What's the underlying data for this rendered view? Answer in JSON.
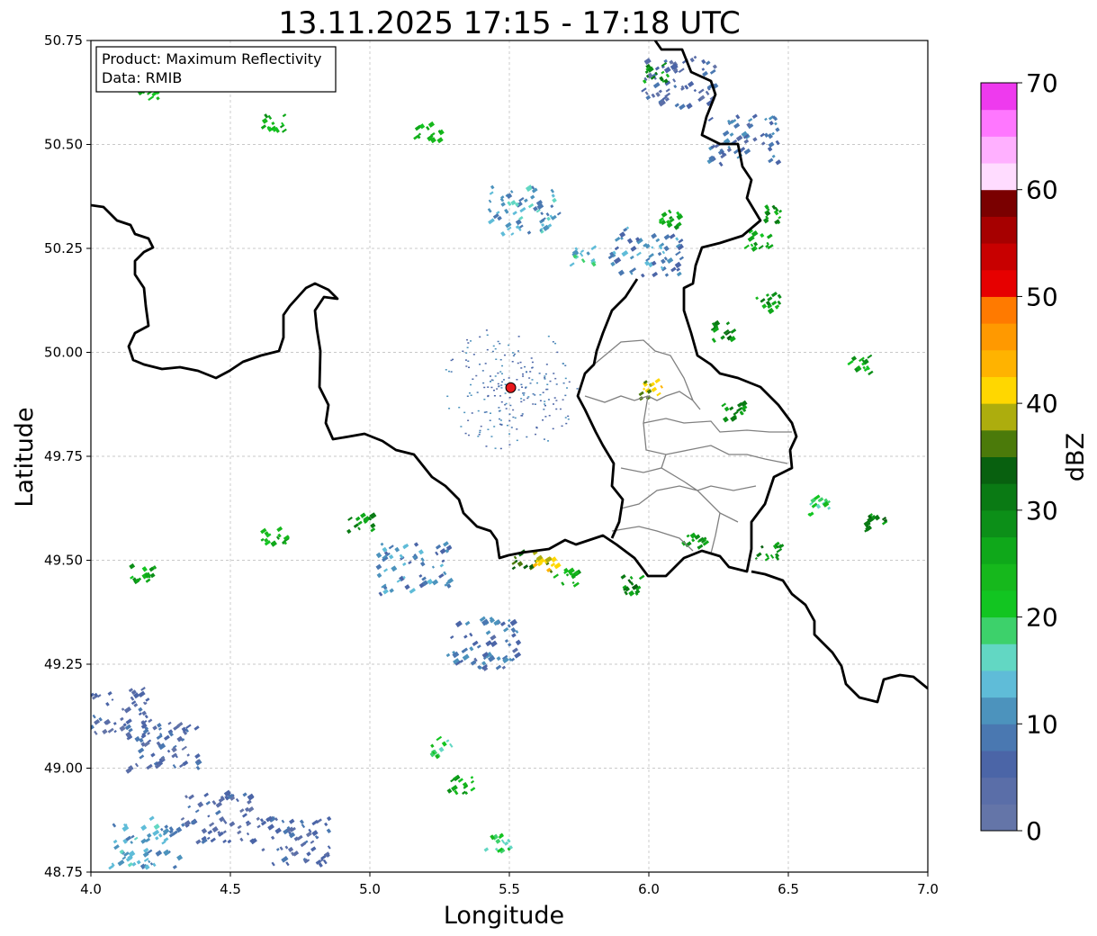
{
  "title": "13.11.2025 17:15 - 17:18 UTC",
  "info_box": {
    "product_line": "Product: Maximum Reflectivity",
    "data_line": "Data: RMIB"
  },
  "axes": {
    "xlabel": "Longitude",
    "ylabel": "Latitude",
    "xlim": [
      4.0,
      7.0
    ],
    "ylim": [
      48.75,
      50.75
    ],
    "xticks": [
      "4.0",
      "4.5",
      "5.0",
      "5.5",
      "6.0",
      "6.5",
      "7.0"
    ],
    "yticks": [
      "48.75",
      "49.00",
      "49.25",
      "49.50",
      "49.75",
      "50.00",
      "50.25",
      "50.50",
      "50.75"
    ],
    "grid": true
  },
  "radar_site": {
    "lon": 5.505,
    "lat": 49.915,
    "color": "#e8191c"
  },
  "colorbar": {
    "label": "dBZ",
    "range": [
      0,
      70
    ],
    "ticks": [
      "0",
      "10",
      "20",
      "30",
      "40",
      "50",
      "60",
      "70"
    ],
    "colors": [
      "#6475a8",
      "#5a6ea8",
      "#4b65a7",
      "#4a78b1",
      "#4c93bd",
      "#5fbcd8",
      "#62d7c3",
      "#3dd16b",
      "#12c521",
      "#16b81c",
      "#0fa81a",
      "#0c8f18",
      "#0a7a14",
      "#08600f",
      "#4b7a0a",
      "#adad0d",
      "#ffd700",
      "#ffb300",
      "#ff9900",
      "#ff7a00",
      "#e60000",
      "#c80000",
      "#a60000",
      "#7a0000",
      "#ffdcff",
      "#ffb0ff",
      "#ff77ff",
      "#ee3aee"
    ]
  },
  "chart_data": {
    "type": "heatmap",
    "title": "13.11.2025 17:15 - 17:18 UTC",
    "xlabel": "Longitude",
    "ylabel": "Latitude",
    "xlim": [
      4.0,
      7.0
    ],
    "ylim": [
      48.75,
      50.75
    ],
    "value_label": "dBZ",
    "value_range": [
      0,
      70
    ],
    "echo_clusters": [
      {
        "lon": 4.18,
        "lat": 48.82,
        "dbz": 12
      },
      {
        "lon": 4.25,
        "lat": 49.05,
        "dbz": 6
      },
      {
        "lon": 4.08,
        "lat": 49.13,
        "dbz": 5
      },
      {
        "lon": 4.45,
        "lat": 48.88,
        "dbz": 5
      },
      {
        "lon": 4.72,
        "lat": 48.82,
        "dbz": 5
      },
      {
        "lon": 5.25,
        "lat": 49.05,
        "dbz": 20
      },
      {
        "lon": 5.32,
        "lat": 48.96,
        "dbz": 25
      },
      {
        "lon": 5.45,
        "lat": 48.82,
        "dbz": 20
      },
      {
        "lon": 5.55,
        "lat": 49.5,
        "dbz": 35
      },
      {
        "lon": 5.62,
        "lat": 49.49,
        "dbz": 40
      },
      {
        "lon": 5.7,
        "lat": 49.46,
        "dbz": 25
      },
      {
        "lon": 5.92,
        "lat": 49.44,
        "dbz": 30
      },
      {
        "lon": 5.15,
        "lat": 49.48,
        "dbz": 10
      },
      {
        "lon": 5.4,
        "lat": 49.3,
        "dbz": 8
      },
      {
        "lon": 4.96,
        "lat": 49.59,
        "dbz": 28
      },
      {
        "lon": 4.65,
        "lat": 49.56,
        "dbz": 25
      },
      {
        "lon": 4.18,
        "lat": 49.47,
        "dbz": 25
      },
      {
        "lon": 6.0,
        "lat": 49.91,
        "dbz": 40
      },
      {
        "lon": 6.3,
        "lat": 49.86,
        "dbz": 30
      },
      {
        "lon": 6.15,
        "lat": 49.55,
        "dbz": 28
      },
      {
        "lon": 6.42,
        "lat": 49.52,
        "dbz": 30
      },
      {
        "lon": 6.8,
        "lat": 49.59,
        "dbz": 30
      },
      {
        "lon": 6.6,
        "lat": 49.63,
        "dbz": 20
      },
      {
        "lon": 6.1,
        "lat": 50.65,
        "dbz": 5
      },
      {
        "lon": 6.33,
        "lat": 50.51,
        "dbz": 8
      },
      {
        "lon": 6.45,
        "lat": 50.33,
        "dbz": 28
      },
      {
        "lon": 6.38,
        "lat": 50.27,
        "dbz": 25
      },
      {
        "lon": 6.08,
        "lat": 50.32,
        "dbz": 25
      },
      {
        "lon": 6.25,
        "lat": 50.05,
        "dbz": 30
      },
      {
        "lon": 6.42,
        "lat": 50.12,
        "dbz": 28
      },
      {
        "lon": 6.75,
        "lat": 49.97,
        "dbz": 25
      },
      {
        "lon": 5.55,
        "lat": 50.34,
        "dbz": 12
      },
      {
        "lon": 5.2,
        "lat": 50.53,
        "dbz": 25
      },
      {
        "lon": 4.65,
        "lat": 50.55,
        "dbz": 25
      },
      {
        "lon": 4.2,
        "lat": 50.63,
        "dbz": 25
      },
      {
        "lon": 5.75,
        "lat": 50.23,
        "dbz": 15
      },
      {
        "lon": 5.98,
        "lat": 50.24,
        "dbz": 10
      },
      {
        "lon": 6.02,
        "lat": 50.67,
        "dbz": 28
      }
    ]
  }
}
